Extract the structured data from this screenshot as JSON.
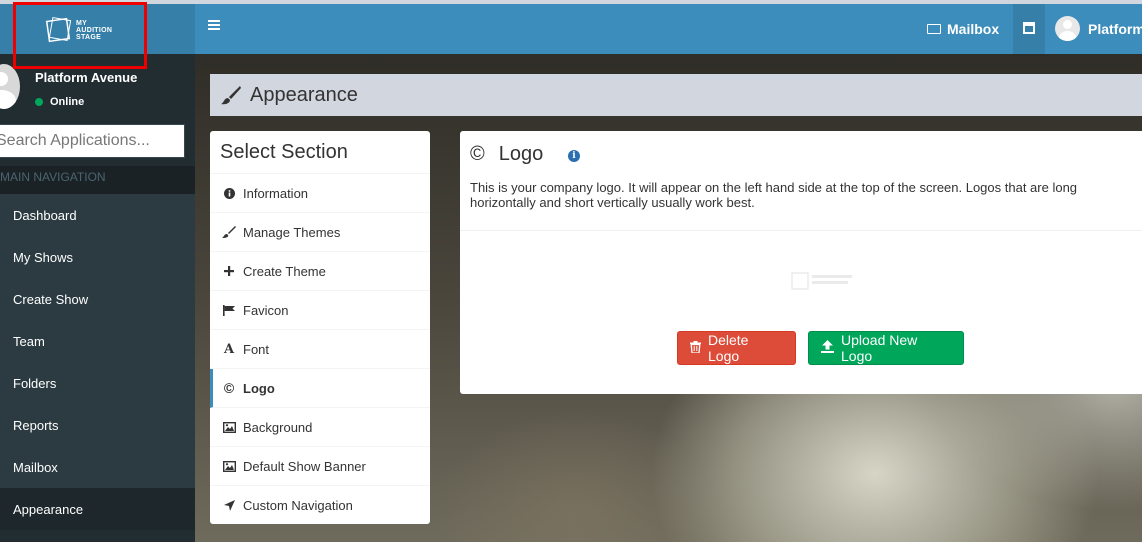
{
  "header": {
    "logo_text_line1": "MY",
    "logo_text_line2": "AUDITION",
    "logo_text_line3": "STAGE",
    "mailbox_label": "Mailbox",
    "user_label": "Platform"
  },
  "sidebar": {
    "user_name": "Platform Avenue",
    "status": "Online",
    "search_placeholder": "Search Applications...",
    "nav_header": "MAIN NAVIGATION",
    "items": [
      {
        "label": "Dashboard"
      },
      {
        "label": "My Shows"
      },
      {
        "label": "Create Show"
      },
      {
        "label": "Team"
      },
      {
        "label": "Folders"
      },
      {
        "label": "Reports"
      },
      {
        "label": "Mailbox"
      },
      {
        "label": "Appearance"
      }
    ]
  },
  "page": {
    "title": "Appearance"
  },
  "sections": {
    "header": "Select Section",
    "items": [
      {
        "label": "Information",
        "icon": "info-circle-icon"
      },
      {
        "label": "Manage Themes",
        "icon": "brush-icon"
      },
      {
        "label": "Create Theme",
        "icon": "plus-icon"
      },
      {
        "label": "Favicon",
        "icon": "flag-icon"
      },
      {
        "label": "Font",
        "icon": "font-icon"
      },
      {
        "label": "Logo",
        "icon": "copyright-icon"
      },
      {
        "label": "Background",
        "icon": "image-icon"
      },
      {
        "label": "Default Show Banner",
        "icon": "image-icon"
      },
      {
        "label": "Custom Navigation",
        "icon": "location-arrow-icon"
      }
    ],
    "active": "Logo"
  },
  "logo_panel": {
    "symbol": "©",
    "title": "Logo",
    "description": "This is your company logo. It will appear on the left hand side at the top of the screen. Logos that are long horizontally and short vertically usually work best.",
    "delete_label": "Delete Logo",
    "upload_label": "Upload New Logo"
  },
  "colors": {
    "header_blue": "#3c8dbc",
    "sidebar_dark": "#222d32",
    "danger": "#dd4b39",
    "success": "#00a65a",
    "highlight_red": "#ee0000"
  }
}
